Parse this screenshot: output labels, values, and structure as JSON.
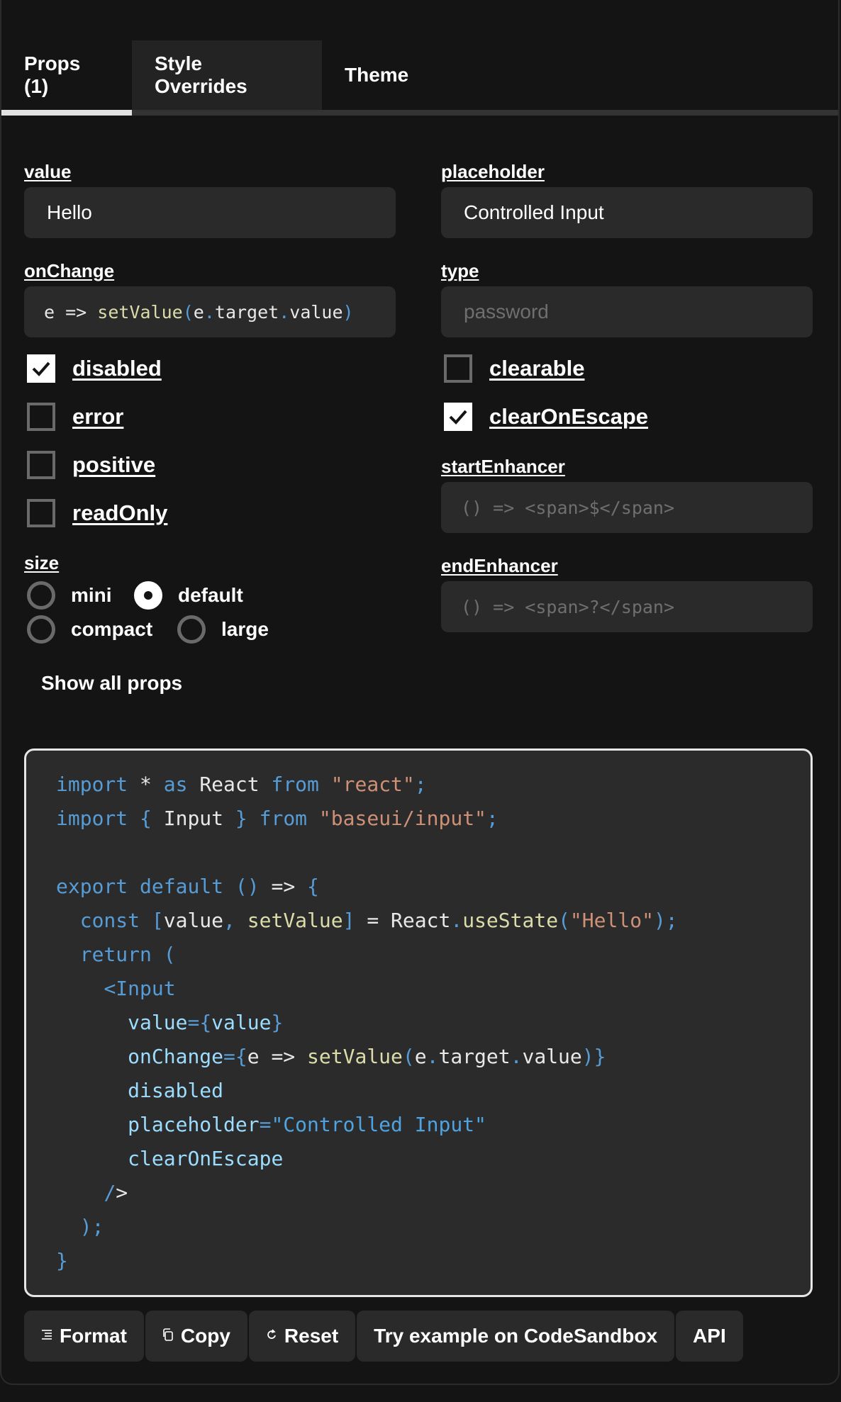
{
  "tabs": [
    {
      "label": "Props (1)",
      "active": true
    },
    {
      "label": "Style Overrides",
      "active": false
    },
    {
      "label": "Theme",
      "active": false
    }
  ],
  "props": {
    "value": {
      "label": "value",
      "input": "Hello"
    },
    "placeholder": {
      "label": "placeholder",
      "input": "Controlled Input"
    },
    "onChange": {
      "label": "onChange",
      "input": "e => setValue(e.target.value)"
    },
    "type": {
      "label": "type",
      "placeholder": "password"
    },
    "checkboxes_left": [
      {
        "label": "disabled",
        "checked": true
      },
      {
        "label": "error",
        "checked": false
      },
      {
        "label": "positive",
        "checked": false
      },
      {
        "label": "readOnly",
        "checked": false
      }
    ],
    "checkboxes_right": [
      {
        "label": "clearable",
        "checked": false
      },
      {
        "label": "clearOnEscape",
        "checked": true
      }
    ],
    "startEnhancer": {
      "label": "startEnhancer",
      "placeholder": "() => <span>$</span>"
    },
    "endEnhancer": {
      "label": "endEnhancer",
      "placeholder": "() => <span>?</span>"
    },
    "size": {
      "label": "size",
      "options": [
        {
          "label": "mini",
          "checked": false
        },
        {
          "label": "default",
          "checked": true
        },
        {
          "label": "compact",
          "checked": false
        },
        {
          "label": "large",
          "checked": false
        }
      ]
    }
  },
  "show_all_label": "Show all props",
  "code_lines": [
    "import * as React from \"react\";",
    "import { Input } from \"baseui/input\";",
    "",
    "export default () => {",
    "  const [value, setValue] = React.useState(\"Hello\");",
    "  return (",
    "    <Input",
    "      value={value}",
    "      onChange={e => setValue(e.target.value)}",
    "      disabled",
    "      placeholder=\"Controlled Input\"",
    "      clearOnEscape",
    "    />",
    "  );",
    "}"
  ],
  "buttons": [
    {
      "label": "Format",
      "icon": "format-icon"
    },
    {
      "label": "Copy",
      "icon": "copy-icon"
    },
    {
      "label": "Reset",
      "icon": "reset-icon"
    },
    {
      "label": "Try example on CodeSandbox",
      "icon": ""
    },
    {
      "label": "API",
      "icon": ""
    }
  ]
}
